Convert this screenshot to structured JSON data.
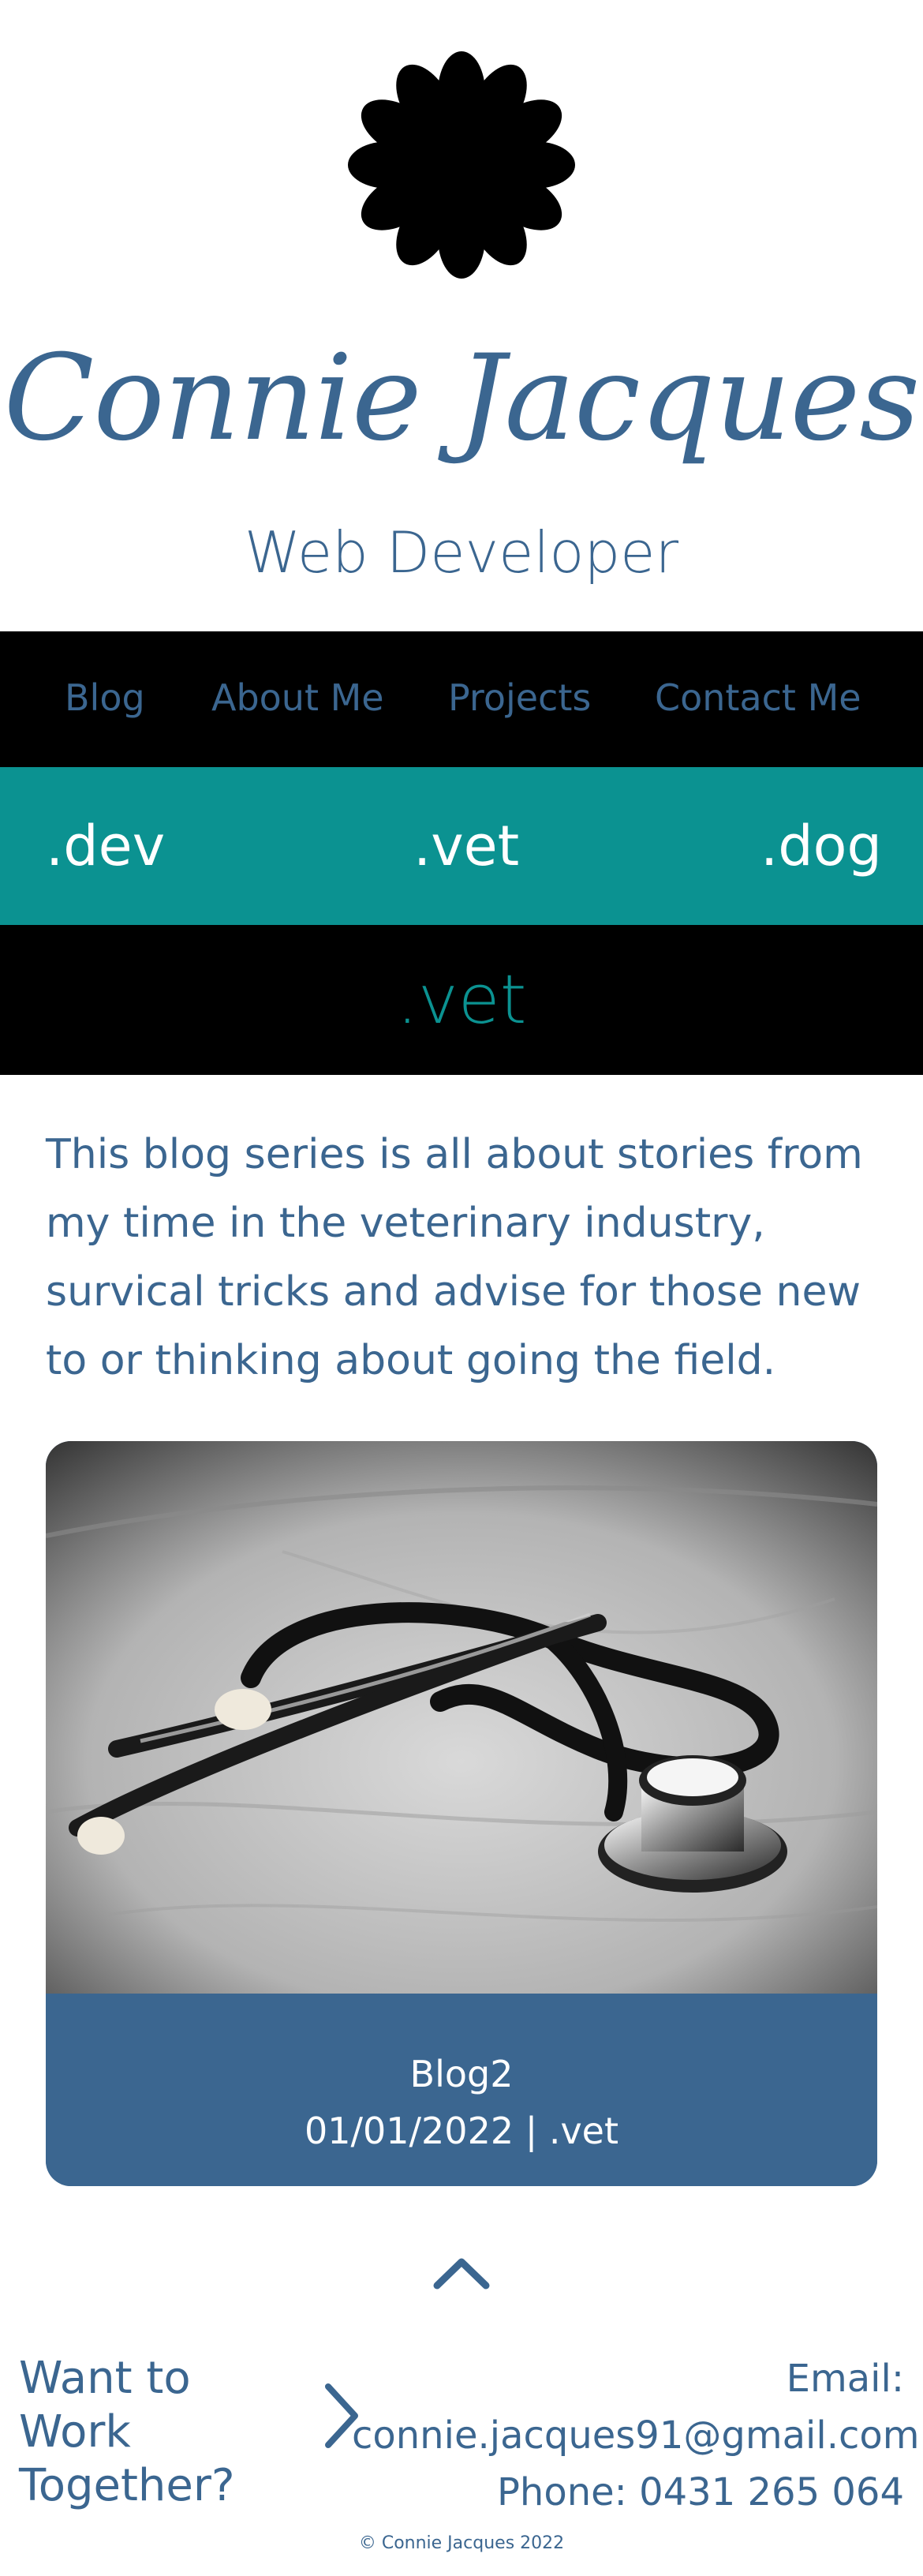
{
  "brand": {
    "logo_icon": "flower-icon",
    "name": "Connie Jacques",
    "role": "Web Developer"
  },
  "nav": {
    "items": [
      {
        "label": "Blog"
      },
      {
        "label": "About Me"
      },
      {
        "label": "Projects"
      },
      {
        "label": "Contact Me"
      }
    ]
  },
  "categories": {
    "items": [
      {
        "label": ".dev"
      },
      {
        "label": ".vet"
      },
      {
        "label": ".dog"
      }
    ],
    "current": ".vet"
  },
  "intro": {
    "text": "This blog series is all about stories from my time in the veterinary industry, survical tricks and advise for those new to or thinking about going the field."
  },
  "post": {
    "image_icon": "stethoscope-photo",
    "title": "Blog2",
    "meta": "01/01/2022 | .vet"
  },
  "footer": {
    "back_to_top_icon": "chevron-up-icon",
    "cta": "Want to Work Together?",
    "cta_icon": "chevron-right-icon",
    "email_label": "Email:",
    "email": "connie.jacques91@gmail.com",
    "phone": "Phone: 0431 265 064",
    "copyright": "© Connie Jacques 2022"
  },
  "colors": {
    "primary": "#3b6690",
    "teal": "#0b9291",
    "black": "#000000",
    "white": "#ffffff"
  }
}
